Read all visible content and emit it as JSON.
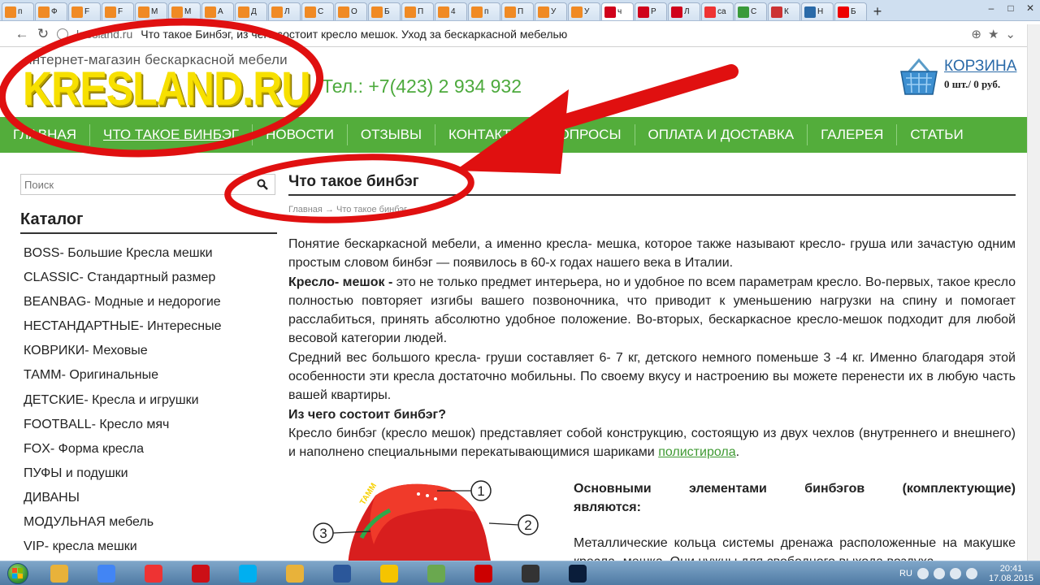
{
  "browser": {
    "tabs": [
      {
        "label": "п",
        "icon": "orange-square-icon",
        "color": "#f08a24"
      },
      {
        "label": "Ф",
        "icon": "orange-square-icon",
        "color": "#f08a24"
      },
      {
        "label": "F",
        "icon": "orange-square-icon",
        "color": "#f08a24"
      },
      {
        "label": "F",
        "icon": "orange-square-icon",
        "color": "#f08a24"
      },
      {
        "label": "M",
        "icon": "orange-square-icon",
        "color": "#f08a24"
      },
      {
        "label": "M",
        "icon": "orange-square-icon",
        "color": "#f08a24"
      },
      {
        "label": "А",
        "icon": "orange-square-icon",
        "color": "#f08a24"
      },
      {
        "label": "Д",
        "icon": "orange-square-icon",
        "color": "#f08a24"
      },
      {
        "label": "Л",
        "icon": "orange-square-icon",
        "color": "#f08a24"
      },
      {
        "label": "С",
        "icon": "orange-square-icon",
        "color": "#f08a24"
      },
      {
        "label": "О",
        "icon": "orange-square-icon",
        "color": "#f08a24"
      },
      {
        "label": "Б",
        "icon": "orange-square-icon",
        "color": "#f08a24"
      },
      {
        "label": "П",
        "icon": "orange-square-icon",
        "color": "#f08a24"
      },
      {
        "label": "4",
        "icon": "orange-square-icon",
        "color": "#f08a24"
      },
      {
        "label": "п",
        "icon": "orange-square-icon",
        "color": "#f08a24"
      },
      {
        "label": "П",
        "icon": "orange-square-icon",
        "color": "#f08a24"
      },
      {
        "label": "У",
        "icon": "orange-square-icon",
        "color": "#f08a24"
      },
      {
        "label": "У",
        "icon": "orange-square-icon",
        "color": "#f08a24"
      },
      {
        "label": "ч",
        "icon": "kresland-k-icon",
        "color": "#d0021b",
        "active": true
      },
      {
        "label": "Р",
        "icon": "kresland-k-icon",
        "color": "#d0021b"
      },
      {
        "label": "Л",
        "icon": "grid-icon",
        "color": "#d0021b"
      },
      {
        "label": "са",
        "icon": "yandex-icon",
        "color": "#e33"
      },
      {
        "label": "С",
        "icon": "shield-icon",
        "color": "#3a9a3a"
      },
      {
        "label": "К",
        "icon": "puzzle-icon",
        "color": "#c33"
      },
      {
        "label": "Н",
        "icon": "globe-icon",
        "color": "#2a6aa8"
      },
      {
        "label": "Б",
        "icon": "youtube-icon",
        "color": "#e00"
      }
    ],
    "url_host": "kresland.ru",
    "url_title": "Что такое Бинбэг, из чего состоит кресло мешок. Уход за бескаркасной мебелью"
  },
  "site": {
    "tagline": "интернет-магазин бескаркасной мебели",
    "logo": "KRESLAND.RU",
    "phone": "Тел.: +7(423) 2 934 932",
    "cart_title": "КОРЗИНА",
    "cart_info": "0 шт./ 0 руб.",
    "menu": [
      "ГЛАВНАЯ",
      "ЧТО ТАКОЕ БИНБЭГ",
      "НОВОСТИ",
      "ОТЗЫВЫ",
      "КОНТАКТЫ",
      "ВОПРОСЫ",
      "ОПЛАТА И ДОСТАВКА",
      "ГАЛЕРЕЯ",
      "СТАТЬИ"
    ],
    "menu_current": 1,
    "accent_green": "#53ad3b",
    "logo_yellow": "#f7e000"
  },
  "sidebar": {
    "search_placeholder": "Поиск",
    "catalog_title": "Каталог",
    "items": [
      "BOSS- Большие Кресла мешки",
      "CLASSIC- Стандартный размер",
      "BEANBAG- Модные и недорогие",
      "НЕСТАНДАРТНЫЕ- Интересные",
      "КОВРИКИ- Меховые",
      "ТАММ- Оригинальные",
      "ДЕТСКИЕ- Кресла и игрушки",
      "FOOTBALL- Кресло мяч",
      "FOX- Форма кресла",
      "ПУФЫ и подушки",
      "ДИВАНЫ",
      "МОДУЛЬНАЯ мебель",
      "VIP- кресла мешки"
    ]
  },
  "content": {
    "title": "Что такое бинбэг",
    "breadcrumb_home": "Главная",
    "breadcrumb_sep": "→",
    "breadcrumb_current": "Что такое бинбэг",
    "p1": "Понятие бескаркасной мебели, а именно кресла- мешка, которое также называют кресло- груша или зачастую одним простым словом бинбэг — появилось в 60-х годах нашего века в Италии.",
    "p2_bold": "Кресло- мешок -",
    "p2": " это не только предмет интерьера, но и удобное по всем параметрам кресло. Во-первых, такое кресло полностью повторяет изгибы вашего позвоночника, что приводит к уменьшению нагрузки на спину и помогает расслабиться, принять абсолютно удобное положение. Во-вторых, бескаркасное кресло-мешок подходит для любой весовой категории людей.",
    "p3": "Средний вес большого кресла- груши составляет 6- 7 кг, детского немного поменьше  3 -4 кг. Именно благодаря этой особенности эти кресла достаточно мобильны. По своему вкусу и настроению вы можете перенести их в любую часть вашей квартиры.",
    "h2": "Из чего состоит бинбэг?",
    "p4": "Кресло бинбэг (кресло мешок) представляет собой конструкцию, состоящую из двух чехлов (внутреннего и внешнего) и наполнено специальными перекатывающимися шариками ",
    "p4_link": "полистирола",
    "p4_end": ".",
    "figure_labels": [
      "1",
      "2",
      "3"
    ],
    "figure_tag": "ТАММ",
    "side_heading": "Основными элементами бинбэгов (комплектующие)",
    "side_heading2": "являются:",
    "side_p": "Металлические кольца системы дренажа расположенные на макушке кресла- мешка. Они нужны для свободного выхода воздуха"
  },
  "taskbar": {
    "apps": [
      {
        "name": "explorer",
        "icon": "folder-icon",
        "color": "#e8b23a"
      },
      {
        "name": "chrome",
        "icon": "chrome-icon",
        "color": "#4285f4"
      },
      {
        "name": "yandex",
        "icon": "yandex-icon",
        "color": "#e33"
      },
      {
        "name": "opera",
        "icon": "opera-icon",
        "color": "#cc0f16"
      },
      {
        "name": "skype",
        "icon": "skype-icon",
        "color": "#00aff0"
      },
      {
        "name": "files",
        "icon": "folder-icon",
        "color": "#e8b23a"
      },
      {
        "name": "word",
        "icon": "word-icon",
        "color": "#2b579a"
      },
      {
        "name": "1c",
        "icon": "1c-icon",
        "color": "#f5c400"
      },
      {
        "name": "installer",
        "icon": "package-icon",
        "color": "#6aa84f"
      },
      {
        "name": "download",
        "icon": "download-icon",
        "color": "#c00"
      },
      {
        "name": "video",
        "icon": "filmstrip-icon",
        "color": "#333"
      },
      {
        "name": "photoshop",
        "icon": "photoshop-icon",
        "color": "#0a1d3a"
      }
    ],
    "lang": "RU",
    "time": "20:41",
    "date": "17.08.2015"
  }
}
